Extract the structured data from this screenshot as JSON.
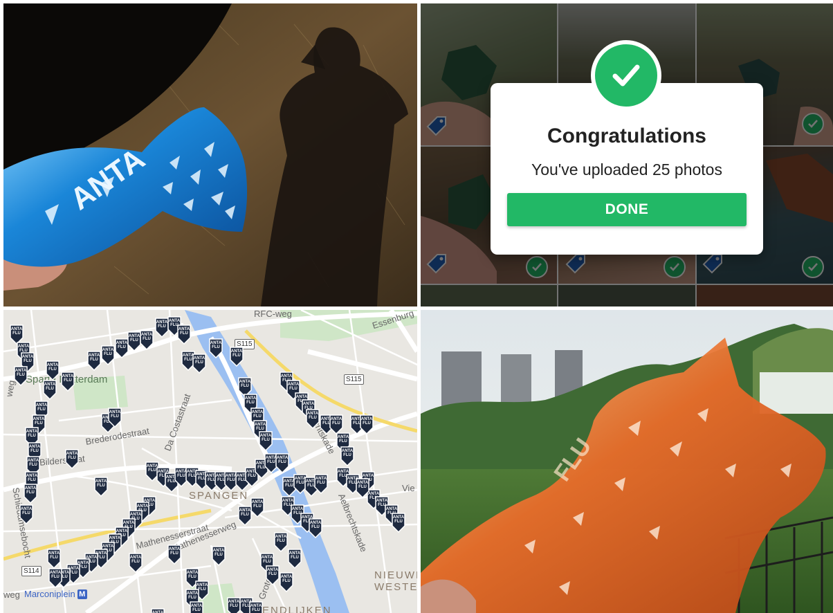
{
  "collage": {
    "panels": [
      "photo-blue-wrapper",
      "upload-gallery",
      "map",
      "photo-orange-wrapper"
    ]
  },
  "wrapper_text": {
    "blue": "ANTA",
    "orange": "FLU"
  },
  "gallery": {
    "dialog": {
      "title": "Congratulations",
      "message": "You've uploaded 25 photos",
      "button": "DONE"
    },
    "colors": {
      "accent": "#22b866"
    }
  },
  "map": {
    "marker_label_line1": "ANTA",
    "marker_label_line2": "FLU",
    "marker_color": "#1e2a40",
    "place_names": {
      "sparta": "Sparta Rotterdam",
      "spangen": "SPANGEN",
      "nieuw_westen_1": "NIEUWE",
      "nieuw_westen_2": "WESTEN",
      "bendlijken": "BENDLIJKEN"
    },
    "streets": {
      "rfc": "RFC-weg",
      "essenburg": "Essenburg",
      "brederode": "Brederodestraat",
      "costa": "Da Costastraat",
      "bilder": "Bilderstraat",
      "aelbrecht": "Aelbrechtskade",
      "aelbrecht2": "Aelbrechtskade",
      "thenesser": "Mathenesserstraat",
      "thenesserweg": "Mathenesserweg",
      "sebocht": "Schiedamsebocht",
      "groot": "Grote",
      "weg": "weg",
      "vie": "Vie",
      "sweg": "weg"
    },
    "roads": {
      "s115a": "S115",
      "s115b": "S115",
      "s114": "S114"
    },
    "metro": {
      "name": "Marconiplein",
      "symbol": "M"
    }
  }
}
